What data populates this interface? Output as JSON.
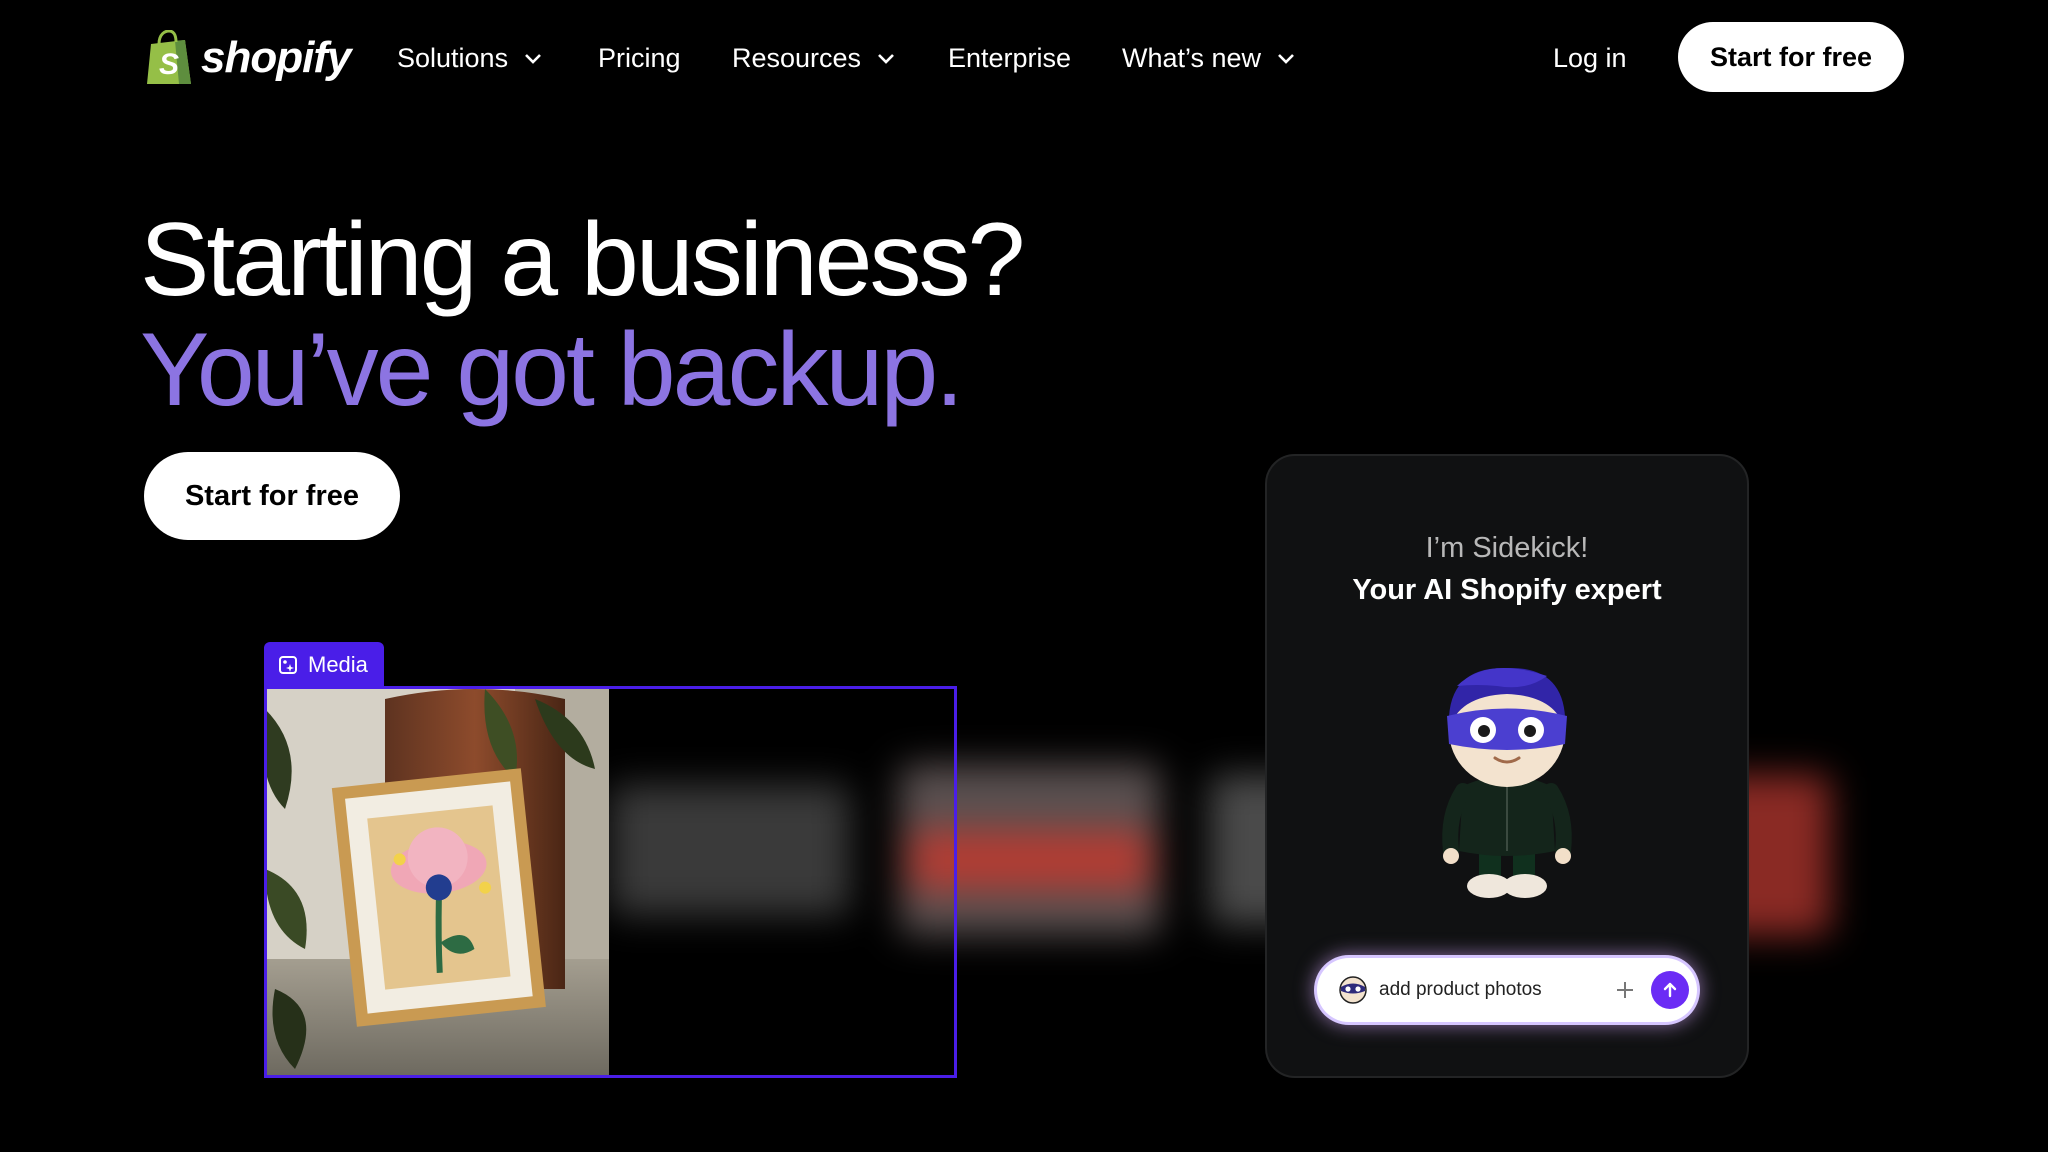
{
  "brand": {
    "name": "shopify",
    "green": "#95bf47",
    "accent_purple": "#8c74e2",
    "media_blue": "#4a1ee8",
    "send_purple": "#6b2cf5"
  },
  "nav": {
    "items": [
      {
        "label": "Solutions",
        "has_dropdown": true
      },
      {
        "label": "Pricing",
        "has_dropdown": false
      },
      {
        "label": "Resources",
        "has_dropdown": true
      },
      {
        "label": "Enterprise",
        "has_dropdown": false
      },
      {
        "label": "What’s new",
        "has_dropdown": true
      }
    ],
    "login": "Log in",
    "cta": "Start for free"
  },
  "hero": {
    "line1": "Starting a business?",
    "line2": "You’ve got backup.",
    "cta": "Start for free"
  },
  "media": {
    "tag": "Media",
    "tag_icon": "media-sparkle-icon"
  },
  "sidekick": {
    "intro": "I’m Sidekick!",
    "subtitle": "Your AI Shopify expert",
    "input_value": "add product photos",
    "plus_icon": "plus-icon",
    "send_icon": "arrow-up-icon"
  }
}
